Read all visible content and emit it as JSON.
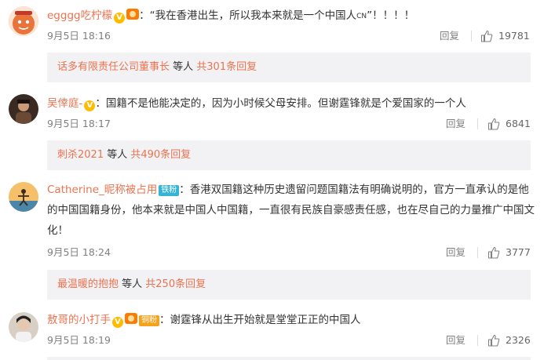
{
  "comments": [
    {
      "username": "egggg吃柠檬",
      "colon": "：",
      "text": "“我在香港出生，所以我本来就是一个中国人",
      "cn_mark": "CN",
      "text_tail": "”！！！！",
      "time": "9月5日 18:16",
      "reply_label": "回复",
      "likes": "19781",
      "sub": {
        "who": "话多有限责任公司董事长",
        "middle": " 等人 ",
        "more": "共301条回复"
      }
    },
    {
      "username": "吴倖庭-",
      "colon": "：",
      "text": "国籍不是他能决定的，因为小时候父母安排。但谢霆锋就是个爱国家的一个人",
      "time": "9月5日 18:17",
      "reply_label": "回复",
      "likes": "6841",
      "sub": {
        "who": "刺杀2021",
        "middle": " 等人 ",
        "more": "共490条回复"
      }
    },
    {
      "username": "Catherine_昵称被占用",
      "fan_badge": "铁粉",
      "colon": "：",
      "text": "香港双国籍这种历史遗留问题国籍法有明确说明的，官方一直承认的是他的中国国籍身份，他本来就是中国人中国籍，一直很有民族自豪感责任感，也在尽自己的力量推广中国文化！",
      "time": "9月5日 18:24",
      "reply_label": "回复",
      "likes": "3777",
      "sub": {
        "who": "最温暖的抱抱",
        "middle": " 等人 ",
        "more": "共250条回复"
      }
    },
    {
      "username": "敖哥的小打手",
      "fan_badge": "铜粉",
      "colon": "：",
      "text": "谢霆锋从出生开始就是堂堂正正的中国人",
      "time": "9月5日 18:19",
      "reply_label": "回复",
      "likes": "2326"
    }
  ],
  "badge_v": "V",
  "colors": {
    "accent": "#eb7350",
    "sub_bg": "#f2f2f5",
    "iron_fan": "#35b4d6",
    "copper_fan": "#f5a21c"
  }
}
